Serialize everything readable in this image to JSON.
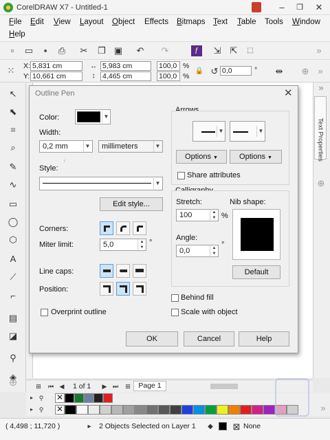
{
  "window": {
    "title": "CorelDRAW X7 - Untitled-1",
    "minimize": "–",
    "restore": "❐",
    "close": "✕"
  },
  "menu": [
    {
      "label": "File",
      "u": "F",
      "rest": "ile"
    },
    {
      "label": "Edit",
      "u": "E",
      "rest": "dit"
    },
    {
      "label": "View",
      "u": "V",
      "rest": "iew"
    },
    {
      "label": "Layout",
      "u": "L",
      "rest": "ayout"
    },
    {
      "label": "Object",
      "u": "O",
      "rest": "bject"
    },
    {
      "label": "Effects",
      "u": "C",
      "rest": "ffects",
      "pre": "Ef"
    },
    {
      "label": "Bitmaps",
      "u": "B",
      "rest": "itmaps"
    },
    {
      "label": "Text",
      "u": "T",
      "rest": "ext"
    },
    {
      "label": "Table",
      "u": "T",
      "rest": "able"
    },
    {
      "label": "Tools",
      "u": "o",
      "rest": "ols"
    },
    {
      "label": "Window",
      "u": "W",
      "rest": "indow"
    },
    {
      "label": "Help",
      "u": "H",
      "rest": "elp"
    }
  ],
  "propbar": {
    "x_label": "X:",
    "x_value": "5,831 cm",
    "y_label": "Y:",
    "y_value": "10,661 cm",
    "w_value": "5,983 cm",
    "h_value": "4,465 cm",
    "scale_x": "100,0",
    "scale_y": "100,0",
    "percent": "%",
    "rotation": "0,0",
    "degree": "°"
  },
  "docker": {
    "label": "Text Properties"
  },
  "pagebar": {
    "page_info": "1 of 1",
    "page_tab": "Page 1"
  },
  "status": {
    "coords": "( 4,498 ; 11,720 )",
    "selection": "2 Objects Selected on Layer 1",
    "fill_none": "None"
  },
  "dialog": {
    "title": "Outline Pen",
    "close": "✕",
    "color_label": "Color:",
    "color_value": "#000000",
    "width_label": "Width:",
    "width_value": "0,2 mm",
    "units_value": "millimeters",
    "style_label": "Style:",
    "edit_style_button": "Edit style...",
    "corners_label": "Corners:",
    "miter_label": "Miter limit:",
    "miter_value": "5,0",
    "miter_unit": "°",
    "linecaps_label": "Line caps:",
    "position_label": "Position:",
    "overprint_label": "Overprint outline",
    "arrows_label": "Arrows",
    "options_left": "Options",
    "options_right": "Options",
    "share_label": "Share attributes",
    "calligraphy_label": "Calligraphy",
    "stretch_label": "Stretch:",
    "stretch_value": "100",
    "stretch_unit": "%",
    "nib_label": "Nib shape:",
    "angle_label": "Angle:",
    "angle_value": "0,0",
    "angle_unit": "°",
    "default_button": "Default",
    "behind_fill_label": "Behind fill",
    "scale_label": "Scale with object",
    "ok_button": "OK",
    "cancel_button": "Cancel",
    "help_button": "Help"
  },
  "palette_colors_top": [
    "#ffffff",
    "#000000",
    "#1a7a2a",
    "#6f7fa3",
    "#222222",
    "#e02020"
  ],
  "palette_colors_bottom": [
    "#ffffff",
    "#000000",
    "#f8f8f8",
    "#ececec",
    "#d0d0d0",
    "#b8b8b8",
    "#a0a0a0",
    "#888888",
    "#707070",
    "#585858",
    "#404040",
    "#1e40e0",
    "#0090e0",
    "#00a040",
    "#f0f020",
    "#f08000",
    "#e02020",
    "#d0208a",
    "#a020c0",
    "#e0a0c0",
    "#d0d0d0"
  ]
}
